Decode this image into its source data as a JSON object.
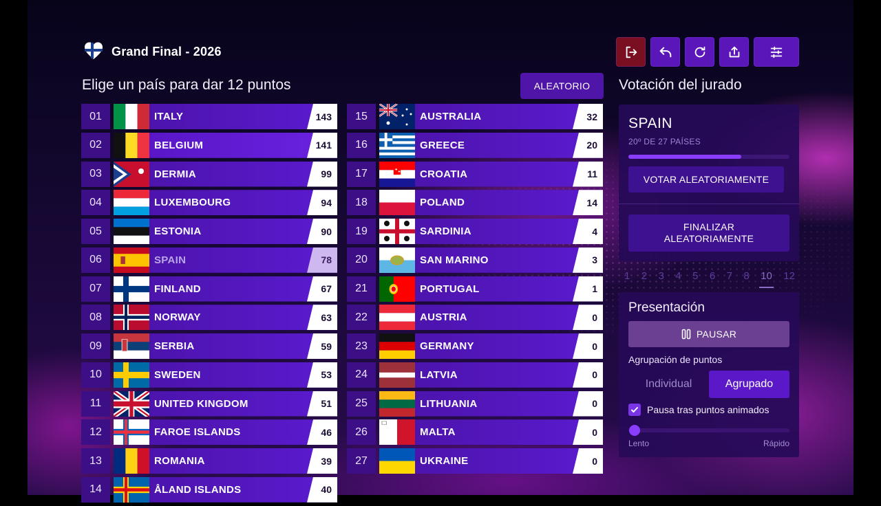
{
  "header": {
    "title": "Grand Final - 2026"
  },
  "toolbar": {
    "buttons": [
      {
        "name": "exit",
        "icon": "exit-icon"
      },
      {
        "name": "undo",
        "icon": "undo-icon"
      },
      {
        "name": "reload",
        "icon": "reload-icon"
      },
      {
        "name": "share",
        "icon": "share-icon"
      },
      {
        "name": "settings",
        "icon": "sliders-icon"
      }
    ]
  },
  "left": {
    "heading": "Elige un país para dar 12 puntos",
    "random_label": "ALEATORIO"
  },
  "countries": [
    {
      "rank": "01",
      "name": "ITALY",
      "points": "143",
      "flag": "italy"
    },
    {
      "rank": "02",
      "name": "BELGIUM",
      "points": "141",
      "flag": "belgium",
      "highlight": true
    },
    {
      "rank": "03",
      "name": "DERMIA",
      "points": "99",
      "flag": "dermia"
    },
    {
      "rank": "04",
      "name": "LUXEMBOURG",
      "points": "94",
      "flag": "luxembourg"
    },
    {
      "rank": "05",
      "name": "ESTONIA",
      "points": "90",
      "flag": "estonia"
    },
    {
      "rank": "06",
      "name": "SPAIN",
      "points": "78",
      "flag": "spain",
      "dimmed": true
    },
    {
      "rank": "07",
      "name": "FINLAND",
      "points": "67",
      "flag": "finland"
    },
    {
      "rank": "08",
      "name": "NORWAY",
      "points": "63",
      "flag": "norway"
    },
    {
      "rank": "09",
      "name": "SERBIA",
      "points": "59",
      "flag": "serbia"
    },
    {
      "rank": "10",
      "name": "SWEDEN",
      "points": "53",
      "flag": "sweden"
    },
    {
      "rank": "11",
      "name": "UNITED KINGDOM",
      "points": "51",
      "flag": "uk"
    },
    {
      "rank": "12",
      "name": "FAROE ISLANDS",
      "points": "46",
      "flag": "faroe"
    },
    {
      "rank": "13",
      "name": "ROMANIA",
      "points": "39",
      "flag": "romania"
    },
    {
      "rank": "14",
      "name": "ÅLAND ISLANDS",
      "points": "40",
      "flag": "aland"
    },
    {
      "rank": "15",
      "name": "AUSTRALIA",
      "points": "32",
      "flag": "australia"
    },
    {
      "rank": "16",
      "name": "GREECE",
      "points": "20",
      "flag": "greece"
    },
    {
      "rank": "17",
      "name": "CROATIA",
      "points": "11",
      "flag": "croatia"
    },
    {
      "rank": "18",
      "name": "POLAND",
      "points": "14",
      "flag": "poland"
    },
    {
      "rank": "19",
      "name": "SARDINIA",
      "points": "4",
      "flag": "sardinia"
    },
    {
      "rank": "20",
      "name": "SAN MARINO",
      "points": "3",
      "flag": "sanmarino"
    },
    {
      "rank": "21",
      "name": "PORTUGAL",
      "points": "1",
      "flag": "portugal"
    },
    {
      "rank": "22",
      "name": "AUSTRIA",
      "points": "0",
      "flag": "austria"
    },
    {
      "rank": "23",
      "name": "GERMANY",
      "points": "0",
      "flag": "germany"
    },
    {
      "rank": "24",
      "name": "LATVIA",
      "points": "0",
      "flag": "latvia"
    },
    {
      "rank": "25",
      "name": "LITHUANIA",
      "points": "0",
      "flag": "lithuania"
    },
    {
      "rank": "26",
      "name": "MALTA",
      "points": "0",
      "flag": "malta"
    },
    {
      "rank": "27",
      "name": "UKRAINE",
      "points": "0",
      "flag": "ukraine"
    }
  ],
  "jury": {
    "heading": "Votación del jurado",
    "country": "SPAIN",
    "position": "20º DE 27 PAÍSES",
    "progress_percent": 70,
    "vote_random_label": "VOTAR ALEATORIAMENTE",
    "finish_random_label_line1": "FINALIZAR",
    "finish_random_label_line2": "ALEATORIAMENTE"
  },
  "points_strip": {
    "values": [
      "1",
      "2",
      "3",
      "4",
      "5",
      "6",
      "7",
      "8",
      "10",
      "12"
    ],
    "current": "10"
  },
  "presentation": {
    "title": "Presentación",
    "pause_label": "PAUSAR",
    "grouping_label": "Agrupación de puntos",
    "individual_label": "Individual",
    "grouped_label": "Agrupado",
    "selected_mode": "Agrupado",
    "pause_after_label": "Pausa tras puntos animados",
    "pause_after_checked": true,
    "speed_fraction": 0.04,
    "slow_label": "Lento",
    "fast_label": "Rápido"
  }
}
